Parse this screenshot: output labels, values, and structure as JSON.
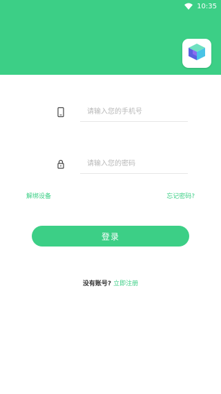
{
  "status_bar": {
    "time": "10:35"
  },
  "login_form": {
    "phone_placeholder": "请输入您的手机号",
    "password_placeholder": "请输入您的密码",
    "unbind_device_label": "解绑设备",
    "forgot_password_label": "忘记密码?",
    "login_button_label": "登录"
  },
  "register": {
    "question": "没有账号?",
    "link_label": "立即注册"
  },
  "colors": {
    "accent": "#3ccf86"
  },
  "icons": {
    "phone": "phone-icon",
    "lock": "lock-icon",
    "wifi": "wifi-icon",
    "logo": "cube-logo-icon"
  }
}
